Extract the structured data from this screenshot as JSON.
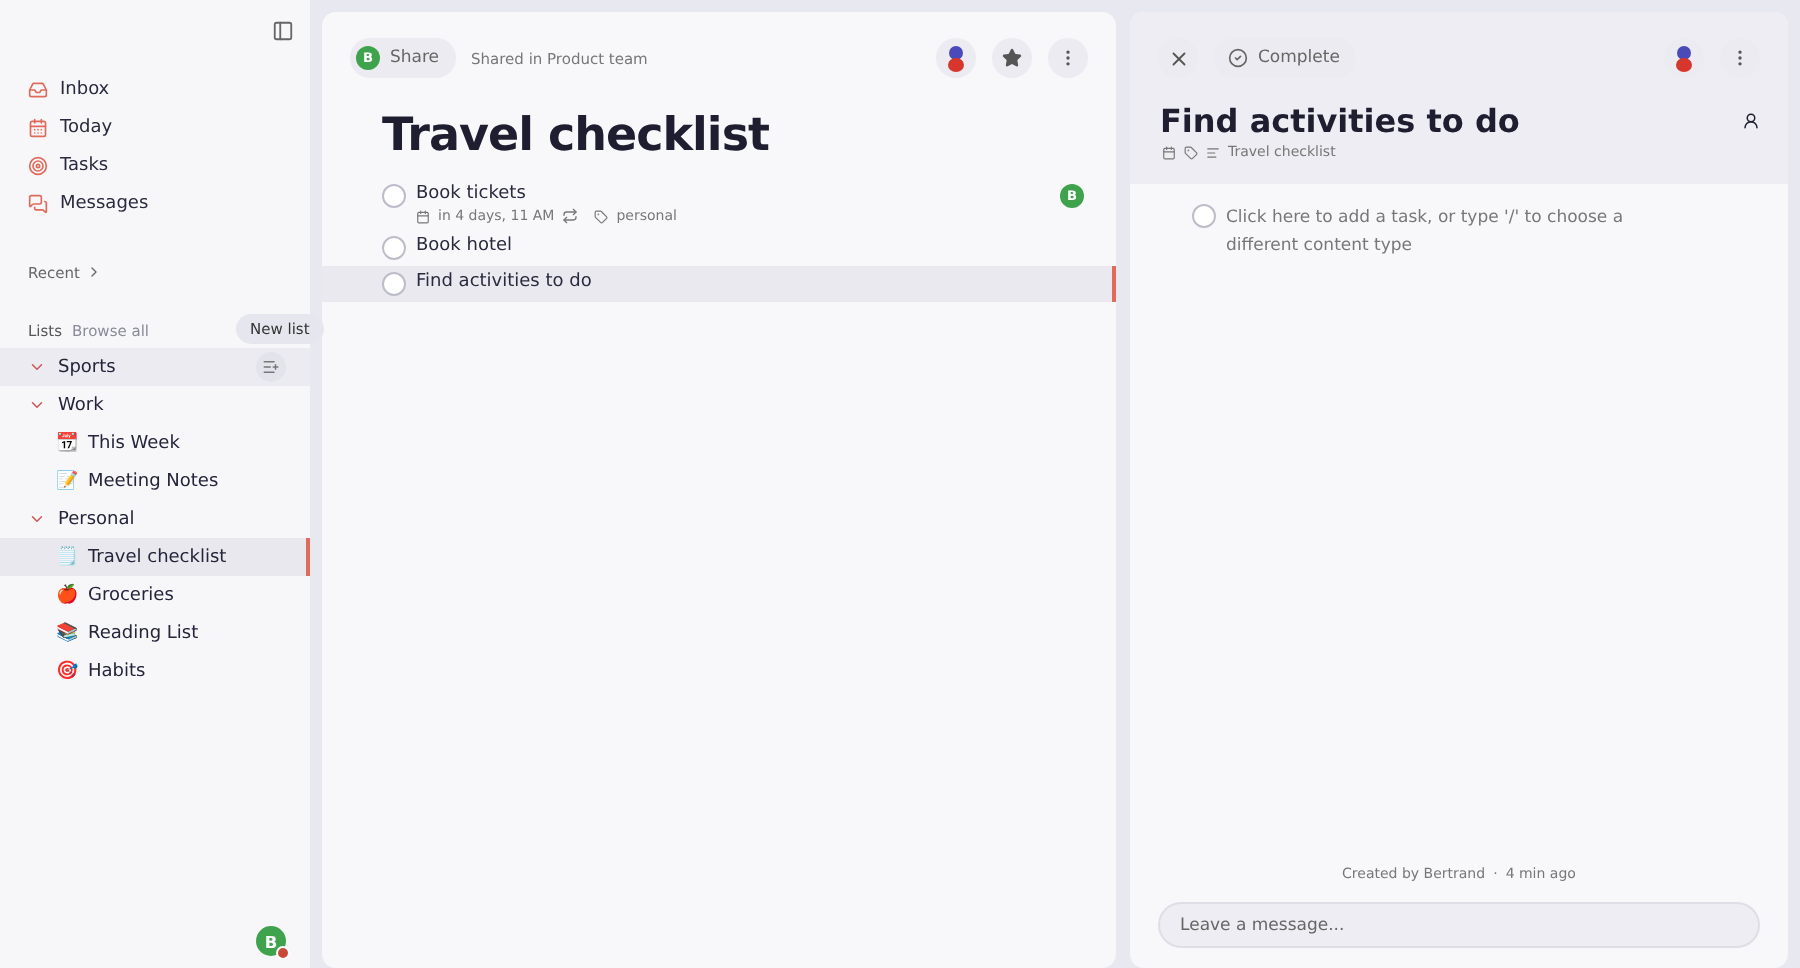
{
  "sidebar": {
    "nav": [
      {
        "label": "Inbox",
        "kind": "inbox"
      },
      {
        "label": "Today",
        "kind": "today"
      },
      {
        "label": "Tasks",
        "kind": "tasks"
      },
      {
        "label": "Messages",
        "kind": "messages"
      }
    ],
    "recent": "Recent",
    "lists_label": "Lists",
    "browse_all": "Browse all",
    "tooltip": "New list",
    "tree": [
      {
        "label": "Sports",
        "expanded": true,
        "highlighted": true
      },
      {
        "label": "Work",
        "expanded": true,
        "highlighted": false,
        "children": [
          {
            "label": "This Week",
            "emoji": "📆",
            "selected": false
          },
          {
            "label": "Meeting Notes",
            "emoji": "📝",
            "selected": false
          }
        ]
      },
      {
        "label": "Personal",
        "expanded": true,
        "highlighted": false,
        "children": [
          {
            "label": "Travel checklist",
            "emoji": "🗒️",
            "selected": true
          },
          {
            "label": "Groceries",
            "emoji": "🍎",
            "selected": false
          },
          {
            "label": "Reading List",
            "emoji": "📚",
            "selected": false
          },
          {
            "label": "Habits",
            "emoji": "🎯",
            "selected": false
          }
        ]
      }
    ],
    "user_avatar": "B"
  },
  "list": {
    "owner_avatar": "B",
    "share": "Share",
    "shared_in": "Shared in Product team",
    "title": "Travel checklist",
    "tasks": [
      {
        "title": "Book tickets",
        "due": "in 4 days, 11 AM",
        "repeat": true,
        "tag": "personal",
        "assignee": "B",
        "selected": false,
        "checked": false
      },
      {
        "title": "Book hotel",
        "selected": false,
        "checked": false
      },
      {
        "title": "Find activities to do",
        "selected": true,
        "checked": false
      }
    ]
  },
  "detail": {
    "complete": "Complete",
    "title": "Find activities to do",
    "list_name": "Travel checklist",
    "placeholder_task": "Click here to add a task, or type '/' to choose a different content type",
    "subtask_checked": false,
    "created_by": "Created by Bertrand",
    "separator": "·",
    "created_ago": "4 min ago",
    "message": {
      "placeholder": "Leave a message..."
    }
  }
}
